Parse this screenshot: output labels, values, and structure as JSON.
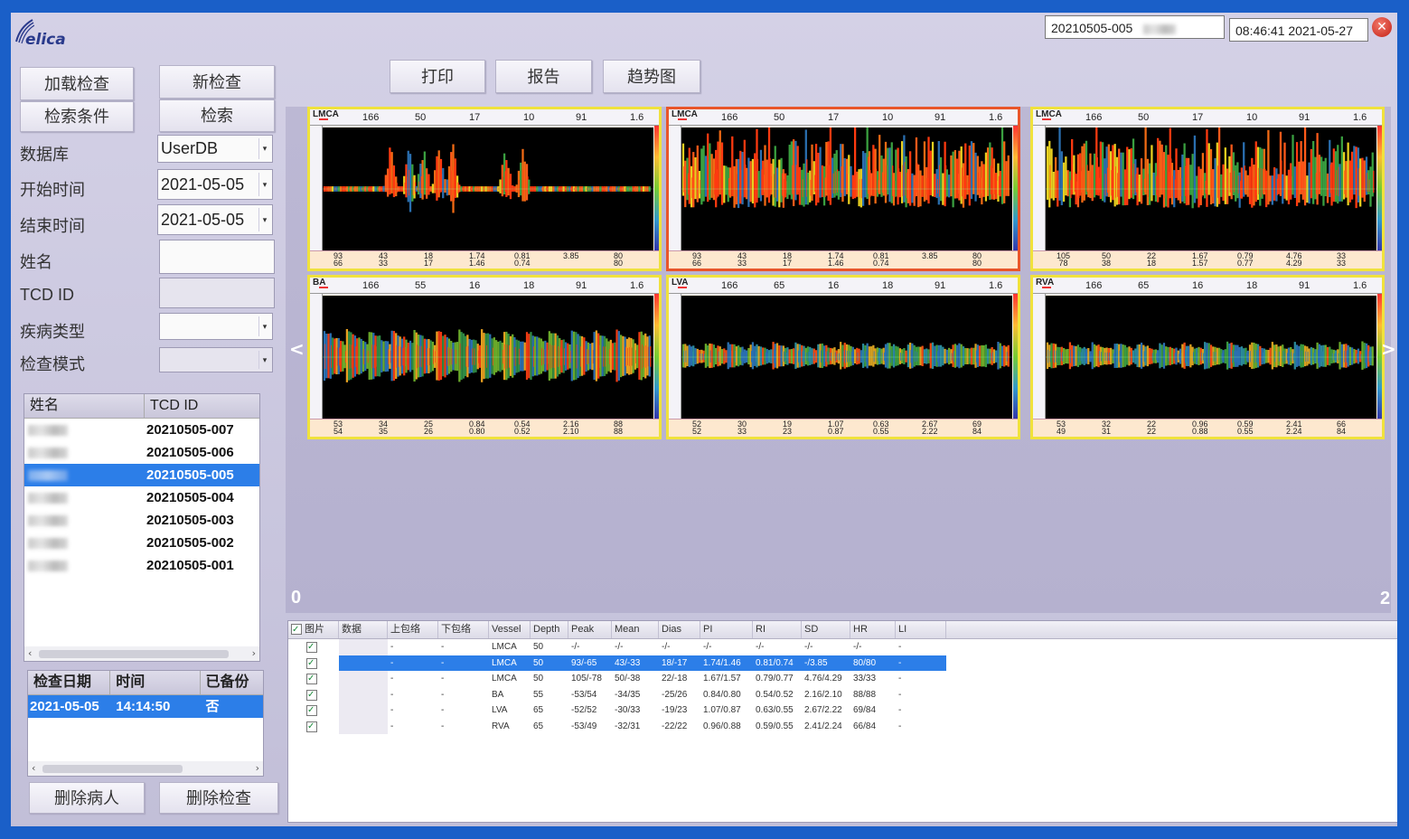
{
  "app": {
    "brand": "elica",
    "current_exam_id": "20210505-005",
    "clock": "08:46:41 2021-05-27"
  },
  "top_buttons": {
    "print": "打印",
    "report": "报告",
    "trend": "趋势图"
  },
  "left": {
    "load_exam": "加载检查",
    "new_exam": "新检查",
    "search_criteria": "检索条件",
    "search": "检索",
    "database_label": "数据库",
    "database_value": "UserDB",
    "start_label": "开始时间",
    "start_value": "2021-05-05",
    "end_label": "结束时间",
    "end_value": "2021-05-05",
    "name_label": "姓名",
    "tcd_label": "TCD ID",
    "disease_label": "疾病类型",
    "mode_label": "检查模式",
    "delete_patient": "删除病人",
    "delete_exam": "删除检查"
  },
  "patients": {
    "headers": [
      "姓名",
      "TCD ID"
    ],
    "rows": [
      {
        "id": "20210505-007"
      },
      {
        "id": "20210505-006"
      },
      {
        "id": "20210505-005",
        "selected": true
      },
      {
        "id": "20210505-004"
      },
      {
        "id": "20210505-003"
      },
      {
        "id": "20210505-002"
      },
      {
        "id": "20210505-001"
      }
    ]
  },
  "exams": {
    "headers": [
      "检查日期",
      "时间",
      "已备份"
    ],
    "rows": [
      {
        "date": "2021-05-05",
        "time": "14:14:50",
        "backup": "否"
      }
    ]
  },
  "viewer": {
    "prev_arrow": "<",
    "next_arrow": ">",
    "page_left": "0",
    "page_right": "2",
    "panels": [
      {
        "vessel": "LMCA",
        "top": [
          "166",
          "50",
          "17",
          "10",
          "91",
          "1.6"
        ],
        "bottom": [
          [
            "93",
            "66"
          ],
          [
            "43",
            "33"
          ],
          [
            "18",
            "17"
          ],
          [
            "1.74",
            "1.46"
          ],
          [
            "0.81",
            "0.74"
          ],
          [
            "",
            "3.85"
          ],
          [
            "80",
            "80"
          ]
        ],
        "pattern": "sparse",
        "colors": "hot"
      },
      {
        "vessel": "LMCA",
        "top": [
          "166",
          "50",
          "17",
          "10",
          "91",
          "1.6"
        ],
        "bottom": [
          [
            "93",
            "66"
          ],
          [
            "43",
            "33"
          ],
          [
            "18",
            "17"
          ],
          [
            "1.74",
            "1.46"
          ],
          [
            "0.81",
            "0.74"
          ],
          [
            "",
            "3.85"
          ],
          [
            "80",
            "80"
          ]
        ],
        "pattern": "dense",
        "colors": "hot",
        "selected": true
      },
      {
        "vessel": "LMCA",
        "top": [
          "166",
          "50",
          "17",
          "10",
          "91",
          "1.6"
        ],
        "bottom": [
          [
            "105",
            "78"
          ],
          [
            "50",
            "38"
          ],
          [
            "22",
            "18"
          ],
          [
            "1.67",
            "1.57"
          ],
          [
            "0.79",
            "0.77"
          ],
          [
            "4.76",
            "4.29"
          ],
          [
            "33",
            "33"
          ]
        ],
        "pattern": "dense",
        "colors": "hot"
      },
      {
        "vessel": "BA",
        "top": [
          "166",
          "55",
          "16",
          "18",
          "91",
          "1.6"
        ],
        "bottom": [
          [
            "53",
            "54"
          ],
          [
            "34",
            "35"
          ],
          [
            "25",
            "26"
          ],
          [
            "0.84",
            "0.80"
          ],
          [
            "0.54",
            "0.52"
          ],
          [
            "2.16",
            "2.10"
          ],
          [
            "88",
            "88"
          ]
        ],
        "pattern": "pulse",
        "colors": "mixed"
      },
      {
        "vessel": "LVA",
        "top": [
          "166",
          "65",
          "16",
          "18",
          "91",
          "1.6"
        ],
        "bottom": [
          [
            "52",
            "52"
          ],
          [
            "30",
            "33"
          ],
          [
            "19",
            "23"
          ],
          [
            "1.07",
            "0.87"
          ],
          [
            "0.63",
            "0.55"
          ],
          [
            "2.67",
            "2.22"
          ],
          [
            "69",
            "84"
          ]
        ],
        "pattern": "pulse",
        "colors": "cool"
      },
      {
        "vessel": "RVA",
        "top": [
          "166",
          "65",
          "16",
          "18",
          "91",
          "1.6"
        ],
        "bottom": [
          [
            "53",
            "49"
          ],
          [
            "32",
            "31"
          ],
          [
            "22",
            "22"
          ],
          [
            "0.96",
            "0.88"
          ],
          [
            "0.59",
            "0.55"
          ],
          [
            "2.41",
            "2.24"
          ],
          [
            "66",
            "84"
          ]
        ],
        "pattern": "pulse",
        "colors": "cool"
      }
    ]
  },
  "table": {
    "headers": [
      "图片",
      "数据",
      "上包络",
      "下包络",
      "Vessel",
      "Depth",
      "Peak",
      "Mean",
      "Dias",
      "PI",
      "RI",
      "SD",
      "HR",
      "LI"
    ],
    "rows": [
      {
        "env_u": "-",
        "env_d": "-",
        "vessel": "LMCA",
        "depth": "50",
        "peak": "-/-",
        "mean": "-/-",
        "dias": "-/-",
        "pi": "-/-",
        "ri": "-/-",
        "sd": "-/-",
        "hr": "-/-",
        "li": "-"
      },
      {
        "env_u": "-",
        "env_d": "-",
        "vessel": "LMCA",
        "depth": "50",
        "peak": "93/-65",
        "mean": "43/-33",
        "dias": "18/-17",
        "pi": "1.74/1.46",
        "ri": "0.81/0.74",
        "sd": "-/3.85",
        "hr": "80/80",
        "li": "-",
        "selected": true
      },
      {
        "env_u": "-",
        "env_d": "-",
        "vessel": "LMCA",
        "depth": "50",
        "peak": "105/-78",
        "mean": "50/-38",
        "dias": "22/-18",
        "pi": "1.67/1.57",
        "ri": "0.79/0.77",
        "sd": "4.76/4.29",
        "hr": "33/33",
        "li": "-"
      },
      {
        "env_u": "-",
        "env_d": "-",
        "vessel": "BA",
        "depth": "55",
        "peak": "-53/54",
        "mean": "-34/35",
        "dias": "-25/26",
        "pi": "0.84/0.80",
        "ri": "0.54/0.52",
        "sd": "2.16/2.10",
        "hr": "88/88",
        "li": "-"
      },
      {
        "env_u": "-",
        "env_d": "-",
        "vessel": "LVA",
        "depth": "65",
        "peak": "-52/52",
        "mean": "-30/33",
        "dias": "-19/23",
        "pi": "1.07/0.87",
        "ri": "0.63/0.55",
        "sd": "2.67/2.22",
        "hr": "69/84",
        "li": "-"
      },
      {
        "env_u": "-",
        "env_d": "-",
        "vessel": "RVA",
        "depth": "65",
        "peak": "-53/49",
        "mean": "-32/31",
        "dias": "-22/22",
        "pi": "0.96/0.88",
        "ri": "0.59/0.55",
        "sd": "2.41/2.24",
        "hr": "66/84",
        "li": "-"
      }
    ]
  }
}
